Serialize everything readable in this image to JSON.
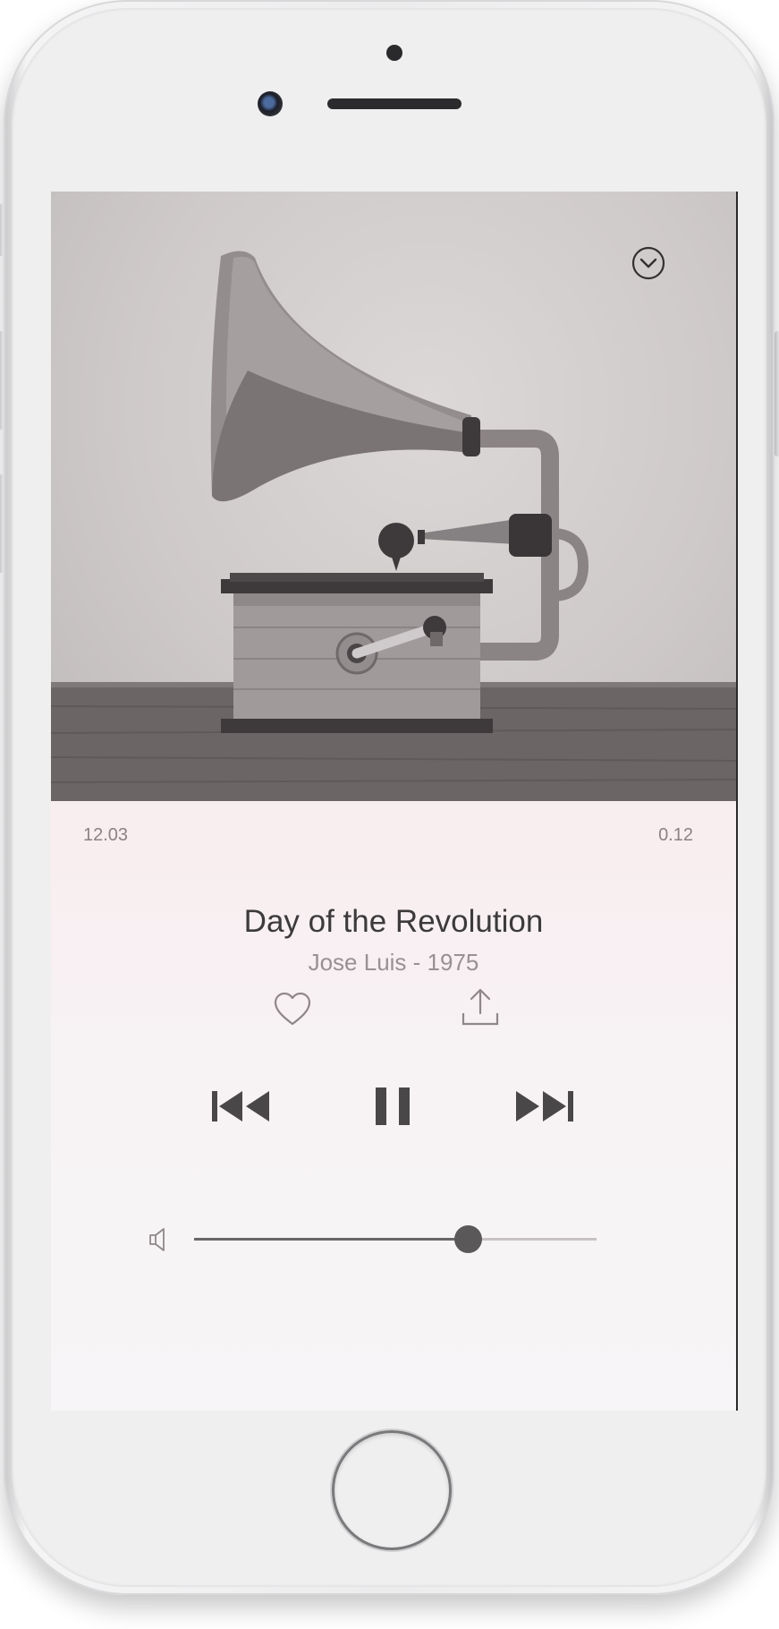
{
  "player": {
    "elapsed_time": "12.03",
    "remaining_time": "0.12",
    "track_title": "Day of the Revolution",
    "artist_line": "Jose Luis - 1975",
    "volume_level": 0.68
  },
  "icons": {
    "dismiss": "chevron-down-circle-icon",
    "like": "heart-icon",
    "share": "share-upload-icon",
    "previous": "skip-previous-icon",
    "play_pause": "pause-icon",
    "next": "skip-next-icon",
    "volume": "speaker-icon"
  },
  "colors": {
    "controls": "#4a4748",
    "background_top": "#fbecec",
    "background_bottom": "#f7f5f7"
  }
}
